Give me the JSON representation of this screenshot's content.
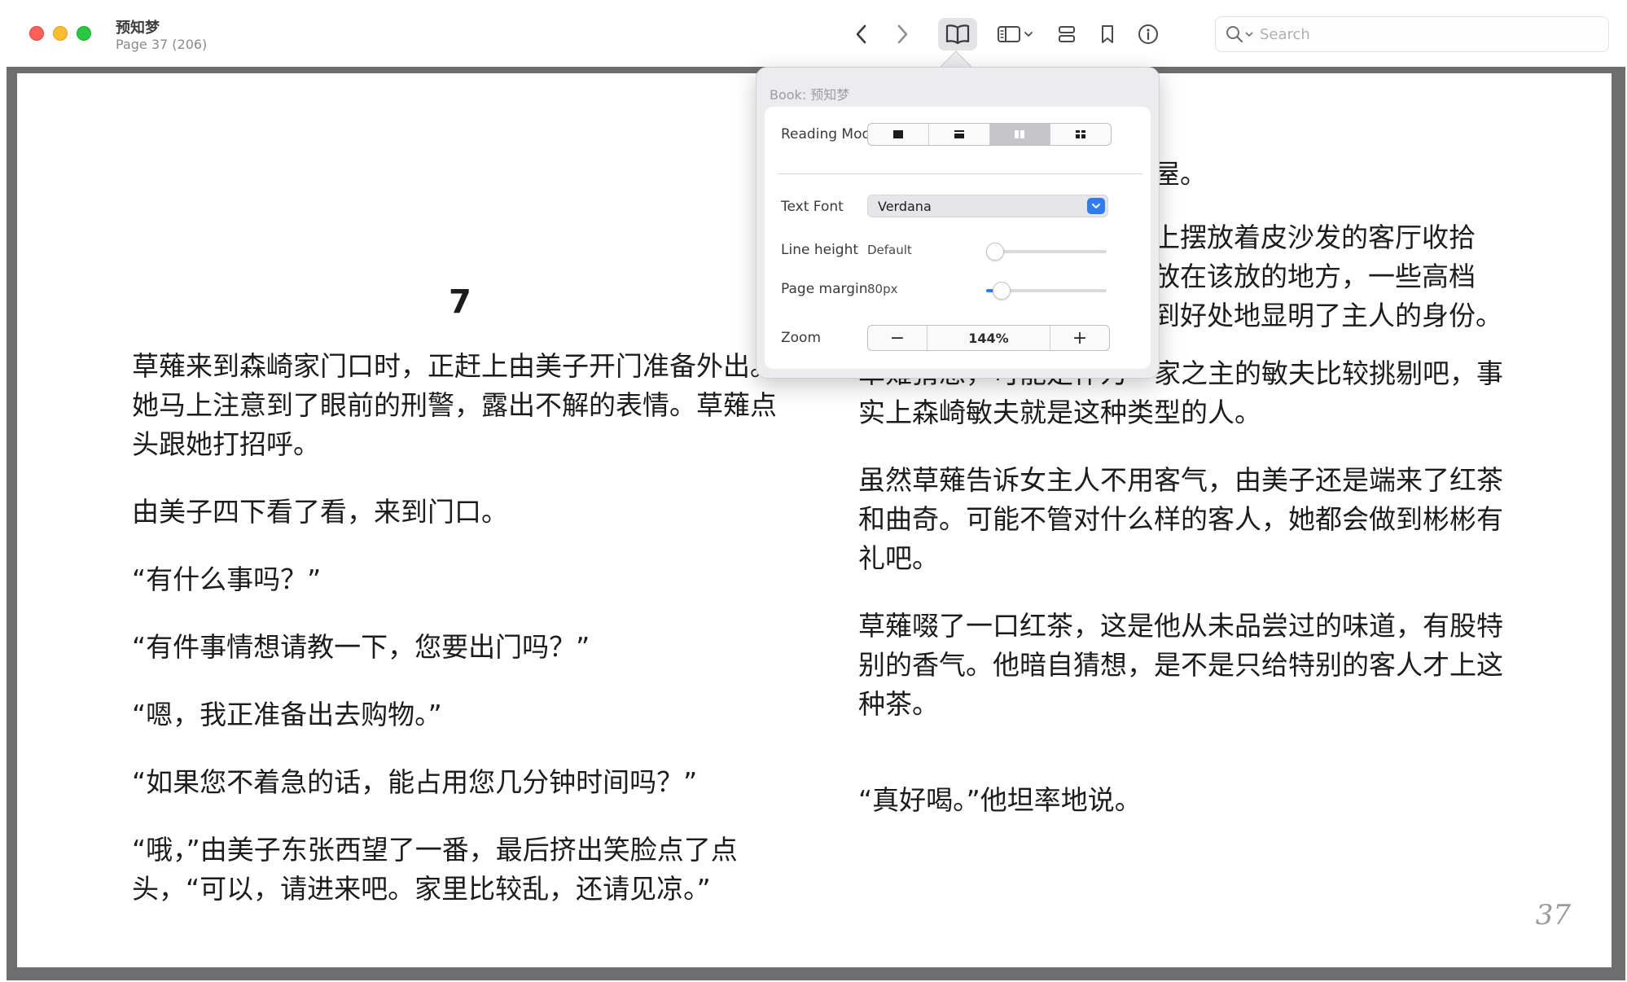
{
  "window": {
    "title": "预知梦",
    "subtitle": "Page 37 (206)"
  },
  "toolbar": {
    "search_placeholder": "Search"
  },
  "book": {
    "chapter_number": "7",
    "page_number": "37",
    "left_paragraphs": [
      "草薙来到森崎家门口时，正赶上由美子开门准备外出。她马上注意到了眼前的刑警，露出不解的表情。草薙点头跟她打招呼。",
      "由美子四下看了看，来到门口。",
      "“有什么事吗？”",
      "“有件事情想请教一下，您要出门吗？”",
      "“嗯，我正准备出去购物。”",
      "“如果您不着急的话，能占用您几分钟时间吗？”",
      "“哦，”由美子东张西望了一番，最后挤出笑脸点了点头，“可以，请进来吧。家里比较乱，还请见凉。”"
    ],
    "right_fragments": [
      "进屋。",
      "际上摆放着皮沙发的客厅收拾",
      "都放在该放的地方，一些高档",
      "恰到好处地显明了主人的身份。"
    ],
    "right_paragraphs": [
      "草薙猜想，可能是作为一家之主的敏夫比较挑剔吧，事实上森崎敏夫就是这种类型的人。",
      "虽然草薙告诉女主人不用客气，由美子还是端来了红茶和曲奇。可能不管对什么样的客人，她都会做到彬彬有礼吧。",
      "草薙啜了一口红茶，这是他从未品尝过的味道，有股特别的香气。他暗自猜想，是不是只给特别的客人才上这种茶。",
      "“真好喝。”他坦率地说。"
    ]
  },
  "popover": {
    "header": "Book: 预知梦",
    "reading_mode": {
      "label": "Reading Mode",
      "options": [
        "single-page",
        "continuous-scroll",
        "two-page",
        "two-page-with-cover"
      ],
      "selected_index": 2
    },
    "text_font": {
      "label": "Text Font",
      "value": "Verdana"
    },
    "line_height": {
      "label": "Line height",
      "value": "Default",
      "level": 0
    },
    "page_margin": {
      "label": "Page margin",
      "value": "80px",
      "level": 0.06
    },
    "zoom": {
      "label": "Zoom",
      "value": "144%",
      "minus": "−",
      "plus": "+"
    }
  },
  "colors": {
    "accent": "#2f7cf6",
    "close": "#fe5f57",
    "minimize": "#febc2e",
    "zoom": "#28c840"
  }
}
